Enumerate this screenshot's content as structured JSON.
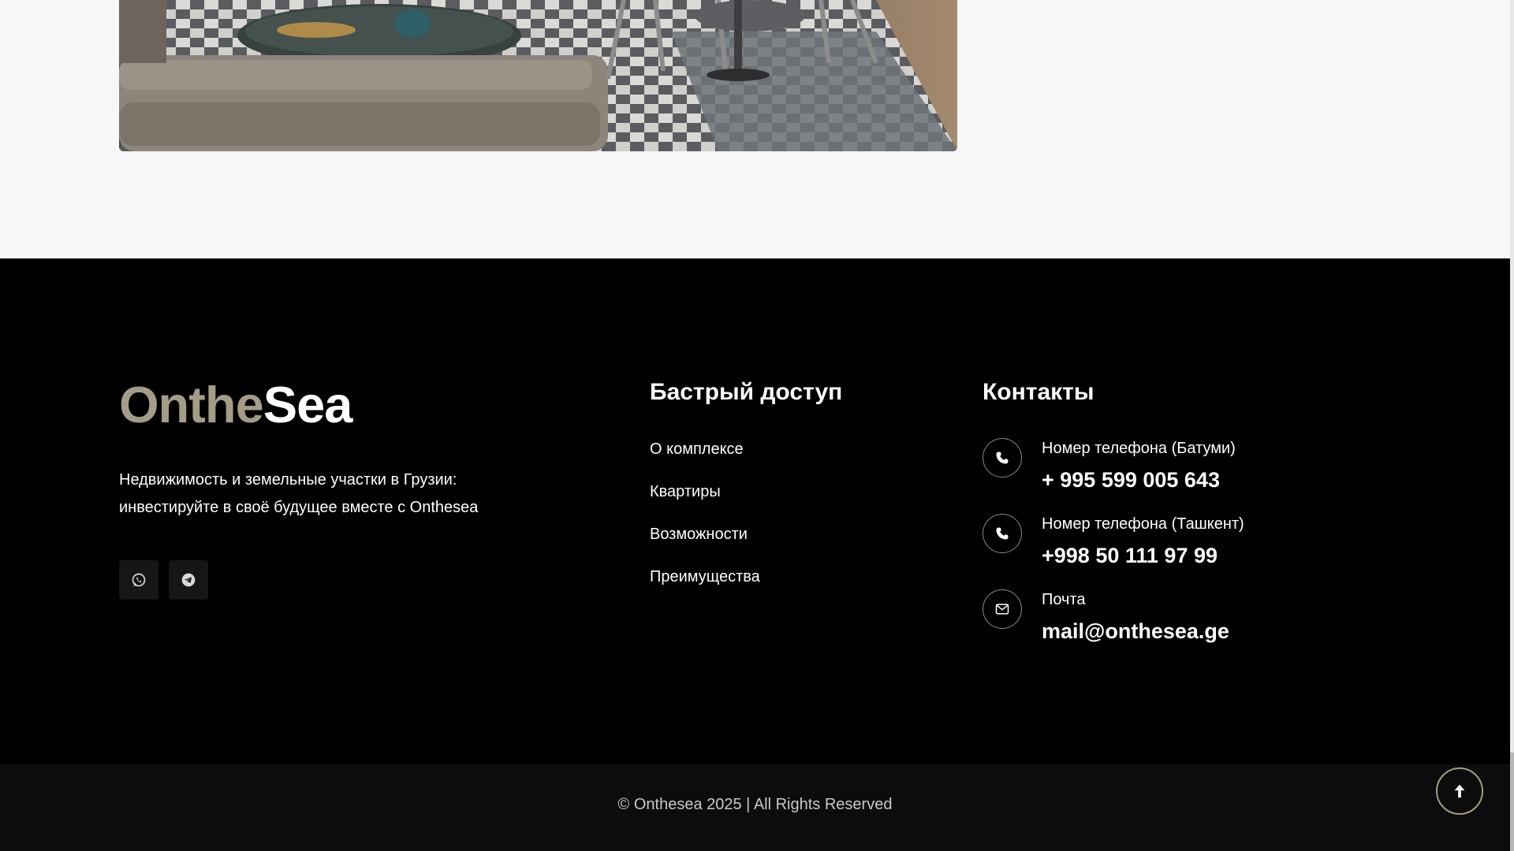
{
  "footer": {
    "brand": {
      "part1": "Onthe",
      "part2": "Sea"
    },
    "tagline_line1": "Недвижимость и земельные участки в Грузии:",
    "tagline_line2": "инвестируйте в своё будущее вместе с Onthesea",
    "socials": [
      {
        "name": "whatsapp",
        "icon": "whatsapp-icon"
      },
      {
        "name": "telegram",
        "icon": "telegram-icon"
      }
    ],
    "quick_access": {
      "title": "Бастрый доступ",
      "links": [
        "О комплексе",
        "Квартиры",
        "Возможности",
        "Преимущества"
      ]
    },
    "contacts": {
      "title": "Контакты",
      "items": [
        {
          "icon": "phone-icon",
          "label": "Номер телефона (Батуми)",
          "value": "+ 995 599 005 643"
        },
        {
          "icon": "phone-icon",
          "label": "Номер телефона (Ташкент)",
          "value": "+998 50 111 97 99"
        },
        {
          "icon": "mail-icon",
          "label": "Почта",
          "value": "mail@onthesea.ge"
        }
      ]
    }
  },
  "bottom": {
    "copyright": "© Onthesea 2025 | All Rights Reserved",
    "to_top_icon": "arrow-up-icon"
  },
  "colors": {
    "accent": "#a39d87",
    "footer_bg": "#000000",
    "bottom_bg": "#0c0c0c",
    "page_bg": "#f7f7f7"
  }
}
